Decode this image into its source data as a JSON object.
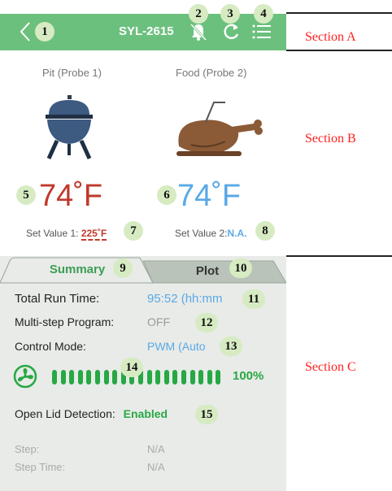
{
  "header": {
    "title": "SYL-2615",
    "back_icon": "chevron-left-icon"
  },
  "badges": [
    "1",
    "2",
    "3",
    "4",
    "5",
    "6",
    "7",
    "8",
    "9",
    "10",
    "11",
    "12",
    "13",
    "14",
    "15"
  ],
  "sections": [
    "Section A",
    "Section B",
    "Section C"
  ],
  "probes": {
    "pit": {
      "label": "Pit (Probe 1)",
      "temp": "74",
      "unit": "˚F",
      "color": "#c0392b"
    },
    "food": {
      "label": "Food (Probe 2)",
      "temp": "74",
      "unit": "˚F",
      "color": "#5aa9e6"
    }
  },
  "setpoints": {
    "one": {
      "label": "Set Value 1: ",
      "value": "225˚F"
    },
    "two": {
      "label": "Set Value 2:",
      "value": "N.A."
    }
  },
  "tabs": {
    "summary": "Summary",
    "plot": "Plot"
  },
  "summary": {
    "run_time": {
      "label": "Total Run Time:",
      "value": "95:52 (hh:mm"
    },
    "multistep": {
      "label": "Multi-step Program:",
      "value": "OFF"
    },
    "control_mode": {
      "label": "Control Mode:",
      "value": "PWM (Auto"
    },
    "fan": {
      "percent": "100%",
      "level": 1.0,
      "segments": 20
    },
    "lid": {
      "label": "Open Lid Detection:",
      "value": "Enabled"
    },
    "step": {
      "label": "Step:",
      "value": "N/A"
    },
    "step_time": {
      "label": "Step Time:",
      "value": "N/A"
    }
  },
  "colors": {
    "accent": "#6cc07e",
    "blue": "#5aa9e6",
    "green": "#27a844",
    "red": "#c0392b"
  }
}
